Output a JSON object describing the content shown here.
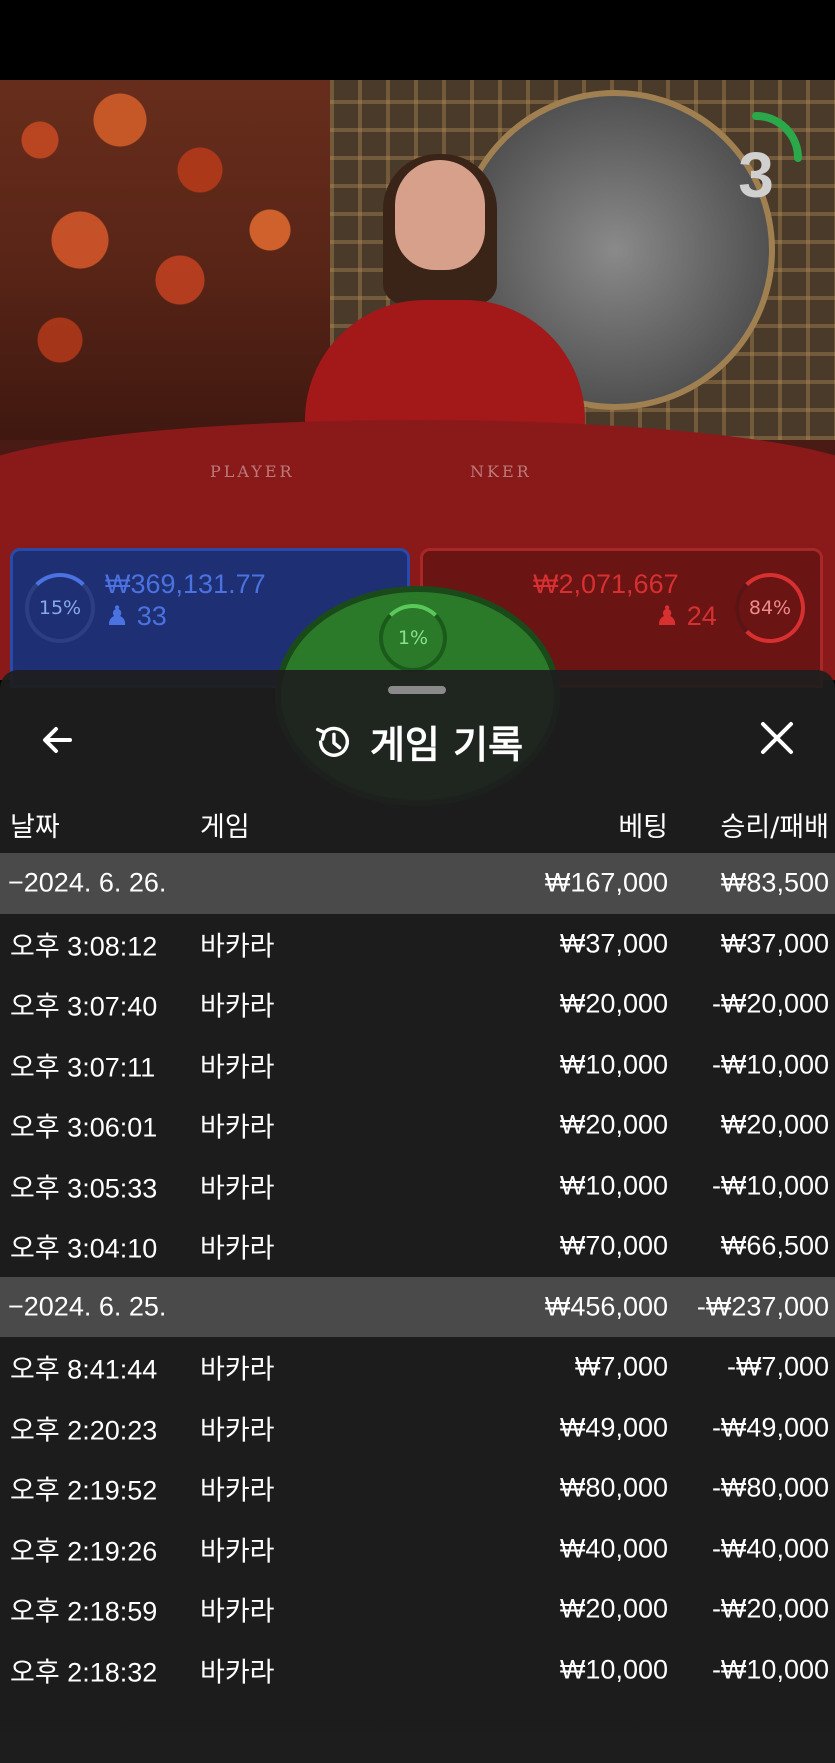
{
  "scene": {
    "timer_value": "3",
    "table_labels": {
      "player": "PLAYER",
      "banker": "NKER"
    }
  },
  "bets": {
    "player": {
      "percent": "15%",
      "amount": "₩369,131.77",
      "count": "33"
    },
    "tie": {
      "percent": "1%"
    },
    "banker": {
      "percent": "84%",
      "amount": "₩2,071,667",
      "count": "24"
    }
  },
  "history": {
    "title": "게임 기록",
    "columns": {
      "date": "날짜",
      "game": "게임",
      "bet": "베팅",
      "result": "승리/패배"
    },
    "rows": [
      {
        "type": "date",
        "time": "−2024. 6. 26.",
        "game": "",
        "bet": "₩167,000",
        "result": "₩83,500"
      },
      {
        "type": "entry",
        "time": "오후 3:08:12",
        "game": "바카라",
        "bet": "₩37,000",
        "result": "₩37,000"
      },
      {
        "type": "entry",
        "time": "오후 3:07:40",
        "game": "바카라",
        "bet": "₩20,000",
        "result": "-₩20,000"
      },
      {
        "type": "entry",
        "time": "오후 3:07:11",
        "game": "바카라",
        "bet": "₩10,000",
        "result": "-₩10,000"
      },
      {
        "type": "entry",
        "time": "오후 3:06:01",
        "game": "바카라",
        "bet": "₩20,000",
        "result": "₩20,000"
      },
      {
        "type": "entry",
        "time": "오후 3:05:33",
        "game": "바카라",
        "bet": "₩10,000",
        "result": "-₩10,000"
      },
      {
        "type": "entry",
        "time": "오후 3:04:10",
        "game": "바카라",
        "bet": "₩70,000",
        "result": "₩66,500"
      },
      {
        "type": "date",
        "time": "−2024. 6. 25.",
        "game": "",
        "bet": "₩456,000",
        "result": "-₩237,000"
      },
      {
        "type": "entry",
        "time": "오후 8:41:44",
        "game": "바카라",
        "bet": "₩7,000",
        "result": "-₩7,000"
      },
      {
        "type": "entry",
        "time": "오후 2:20:23",
        "game": "바카라",
        "bet": "₩49,000",
        "result": "-₩49,000"
      },
      {
        "type": "entry",
        "time": "오후 2:19:52",
        "game": "바카라",
        "bet": "₩80,000",
        "result": "-₩80,000"
      },
      {
        "type": "entry",
        "time": "오후 2:19:26",
        "game": "바카라",
        "bet": "₩40,000",
        "result": "-₩40,000"
      },
      {
        "type": "entry",
        "time": "오후 2:18:59",
        "game": "바카라",
        "bet": "₩20,000",
        "result": "-₩20,000"
      },
      {
        "type": "entry",
        "time": "오후 2:18:32",
        "game": "바카라",
        "bet": "₩10,000",
        "result": "-₩10,000"
      }
    ]
  },
  "colors": {
    "player_blue": "#4a72e0",
    "banker_red": "#d83030",
    "tie_green": "#3a9a3a",
    "date_row_bg": "#4a4a4a",
    "sheet_bg": "#1e1e1e"
  },
  "icons": {
    "back": "arrow-left-icon",
    "history": "history-icon",
    "close": "close-icon"
  }
}
